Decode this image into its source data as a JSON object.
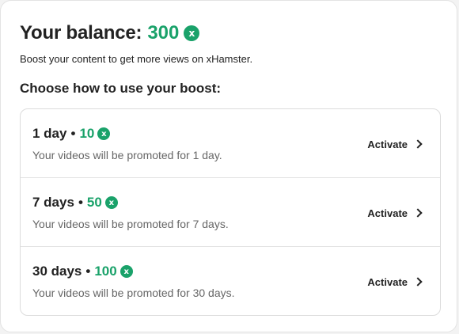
{
  "balance": {
    "label": "Your balance:",
    "amount": "300",
    "currency_icon": "x-coin-icon"
  },
  "subtitle": "Boost your content to get more views on xHamster.",
  "section_title": "Choose how to use your boost:",
  "options": [
    {
      "duration": "1 day",
      "separator": "•",
      "cost": "10",
      "description": "Your videos will be promoted for 1 day.",
      "action": "Activate"
    },
    {
      "duration": "7 days",
      "separator": "•",
      "cost": "50",
      "description": "Your videos will be promoted for 7 days.",
      "action": "Activate"
    },
    {
      "duration": "30 days",
      "separator": "•",
      "cost": "100",
      "description": "Your videos will be promoted for 30 days.",
      "action": "Activate"
    }
  ],
  "colors": {
    "accent": "#1aa26a",
    "text": "#222222",
    "muted": "#666666"
  },
  "coin_glyph": "x"
}
